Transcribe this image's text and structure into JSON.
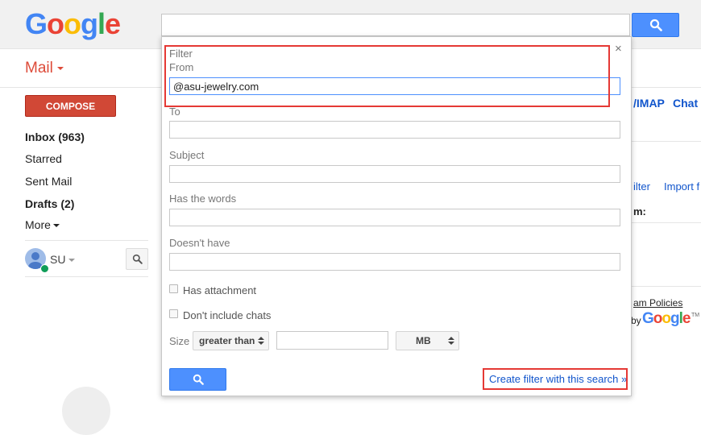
{
  "header": {
    "logo": [
      "G",
      "o",
      "o",
      "g",
      "l",
      "e"
    ],
    "search_value": ""
  },
  "nav": {
    "mail_label": "Mail",
    "compose_label": "COMPOSE",
    "items": [
      {
        "label": "Inbox (963)",
        "bold": true
      },
      {
        "label": "Starred",
        "bold": false
      },
      {
        "label": "Sent Mail",
        "bold": false
      },
      {
        "label": "Drafts (2)",
        "bold": true
      },
      {
        "label": "More",
        "bold": false
      }
    ],
    "account_label": "SU"
  },
  "background": {
    "imap_text": "/IMAP",
    "chat_text": "Chat",
    "filter_text": "ilter",
    "import_text": "Import f",
    "m_text": "m:",
    "policies_text": "am Policies",
    "by_text": "by",
    "tm": "TM"
  },
  "filter": {
    "title": "Filter",
    "close_label": "×",
    "from_label": "From",
    "from_value": "@asu-jewelry.com",
    "to_label": "To",
    "to_value": "",
    "subject_label": "Subject",
    "subject_value": "",
    "has_words_label": "Has the words",
    "has_words_value": "",
    "doesnt_have_label": "Doesn't have",
    "doesnt_have_value": "",
    "has_attachment_label": "Has attachment",
    "has_attachment_checked": false,
    "no_chats_label": "Don't include chats",
    "no_chats_checked": false,
    "size_label": "Size",
    "size_op": "greater than",
    "size_value": "",
    "size_unit": "MB",
    "create_filter_label": "Create filter with this search »"
  },
  "colors": {
    "compose_red": "#d14836",
    "search_blue": "#4d90fe",
    "link_blue": "#1155cc",
    "annotation_red": "#e53935"
  },
  "icons": [
    "search-icon",
    "close-icon",
    "avatar-icon",
    "dropdown-caret-icon",
    "updown-icon"
  ]
}
